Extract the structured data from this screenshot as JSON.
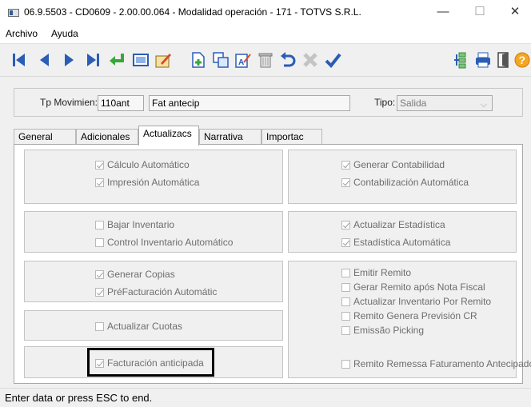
{
  "window": {
    "title": "06.9.5503 - CD0609 - 2.00.00.064 - Modalidad operación - 171 - TOTVS S.R.L.",
    "minimize": "—",
    "maximize": "☐",
    "close": "✕"
  },
  "menu": [
    "Archivo",
    "Ayuda"
  ],
  "toolbar": {
    "icons": [
      "first-record-icon",
      "previous-record-icon",
      "next-record-icon",
      "last-record-icon",
      "confirm-return-icon",
      "view-record-icon",
      "edit-record-icon",
      "new-record-icon",
      "copy-record-icon",
      "edit-field-icon",
      "delete-record-icon",
      "undo-icon",
      "cancel-icon",
      "save-icon",
      "zoom-icon",
      "print-icon",
      "exit-icon",
      "help-icon"
    ],
    "help_glyph": "?"
  },
  "header": {
    "tp_label": "Tp Movimien:",
    "tp_code": "110ant",
    "tp_desc": "Fat antecip",
    "tipo_label": "Tipo:",
    "tipo_value": "Salida",
    "chevron": "⌵"
  },
  "tabs": [
    "General",
    "Adicionales",
    "Actualizacs",
    "Narrativa",
    "Importac"
  ],
  "active_tab": "Actualizacs",
  "checkboxes": {
    "calculo": {
      "label": "Cálculo Automático",
      "checked": true
    },
    "impresion": {
      "label": "Impresión Automática",
      "checked": true
    },
    "generar_contabilidad": {
      "label": "Generar Contabilidad",
      "checked": true
    },
    "contabilizacion": {
      "label": "Contabilización Automática",
      "checked": true
    },
    "bajar_inventario": {
      "label": "Bajar Inventario",
      "checked": false
    },
    "control_inventario": {
      "label": "Control Inventario Automático",
      "checked": false
    },
    "actualizar_estadistica": {
      "label": "Actualizar Estadística",
      "checked": true
    },
    "estadistica_auto": {
      "label": "Estadística Automática",
      "checked": true
    },
    "generar_copias": {
      "label": "Generar Copias",
      "checked": true
    },
    "prefacturacion": {
      "label": "PréFacturación Automátic",
      "checked": true
    },
    "emitir_remito": {
      "label": "Emitir Remito",
      "checked": false
    },
    "gerar_remito": {
      "label": "Gerar Remito após Nota Fiscal",
      "checked": false
    },
    "actualizar_inv_remito": {
      "label": "Actualizar Inventario Por Remito",
      "checked": false
    },
    "remito_genera": {
      "label": "Remito Genera Previsión CR",
      "checked": false
    },
    "emissao_picking": {
      "label": "Emissão Picking",
      "checked": false
    },
    "actualizar_cuotas": {
      "label": "Actualizar Cuotas",
      "checked": false
    },
    "facturacion_anticipada": {
      "label": "Facturación anticipada",
      "checked": true
    },
    "remito_remessa": {
      "label": "Remito Remessa Faturamento Antecipado",
      "checked": false
    }
  },
  "status": "Enter data or press ESC to end."
}
